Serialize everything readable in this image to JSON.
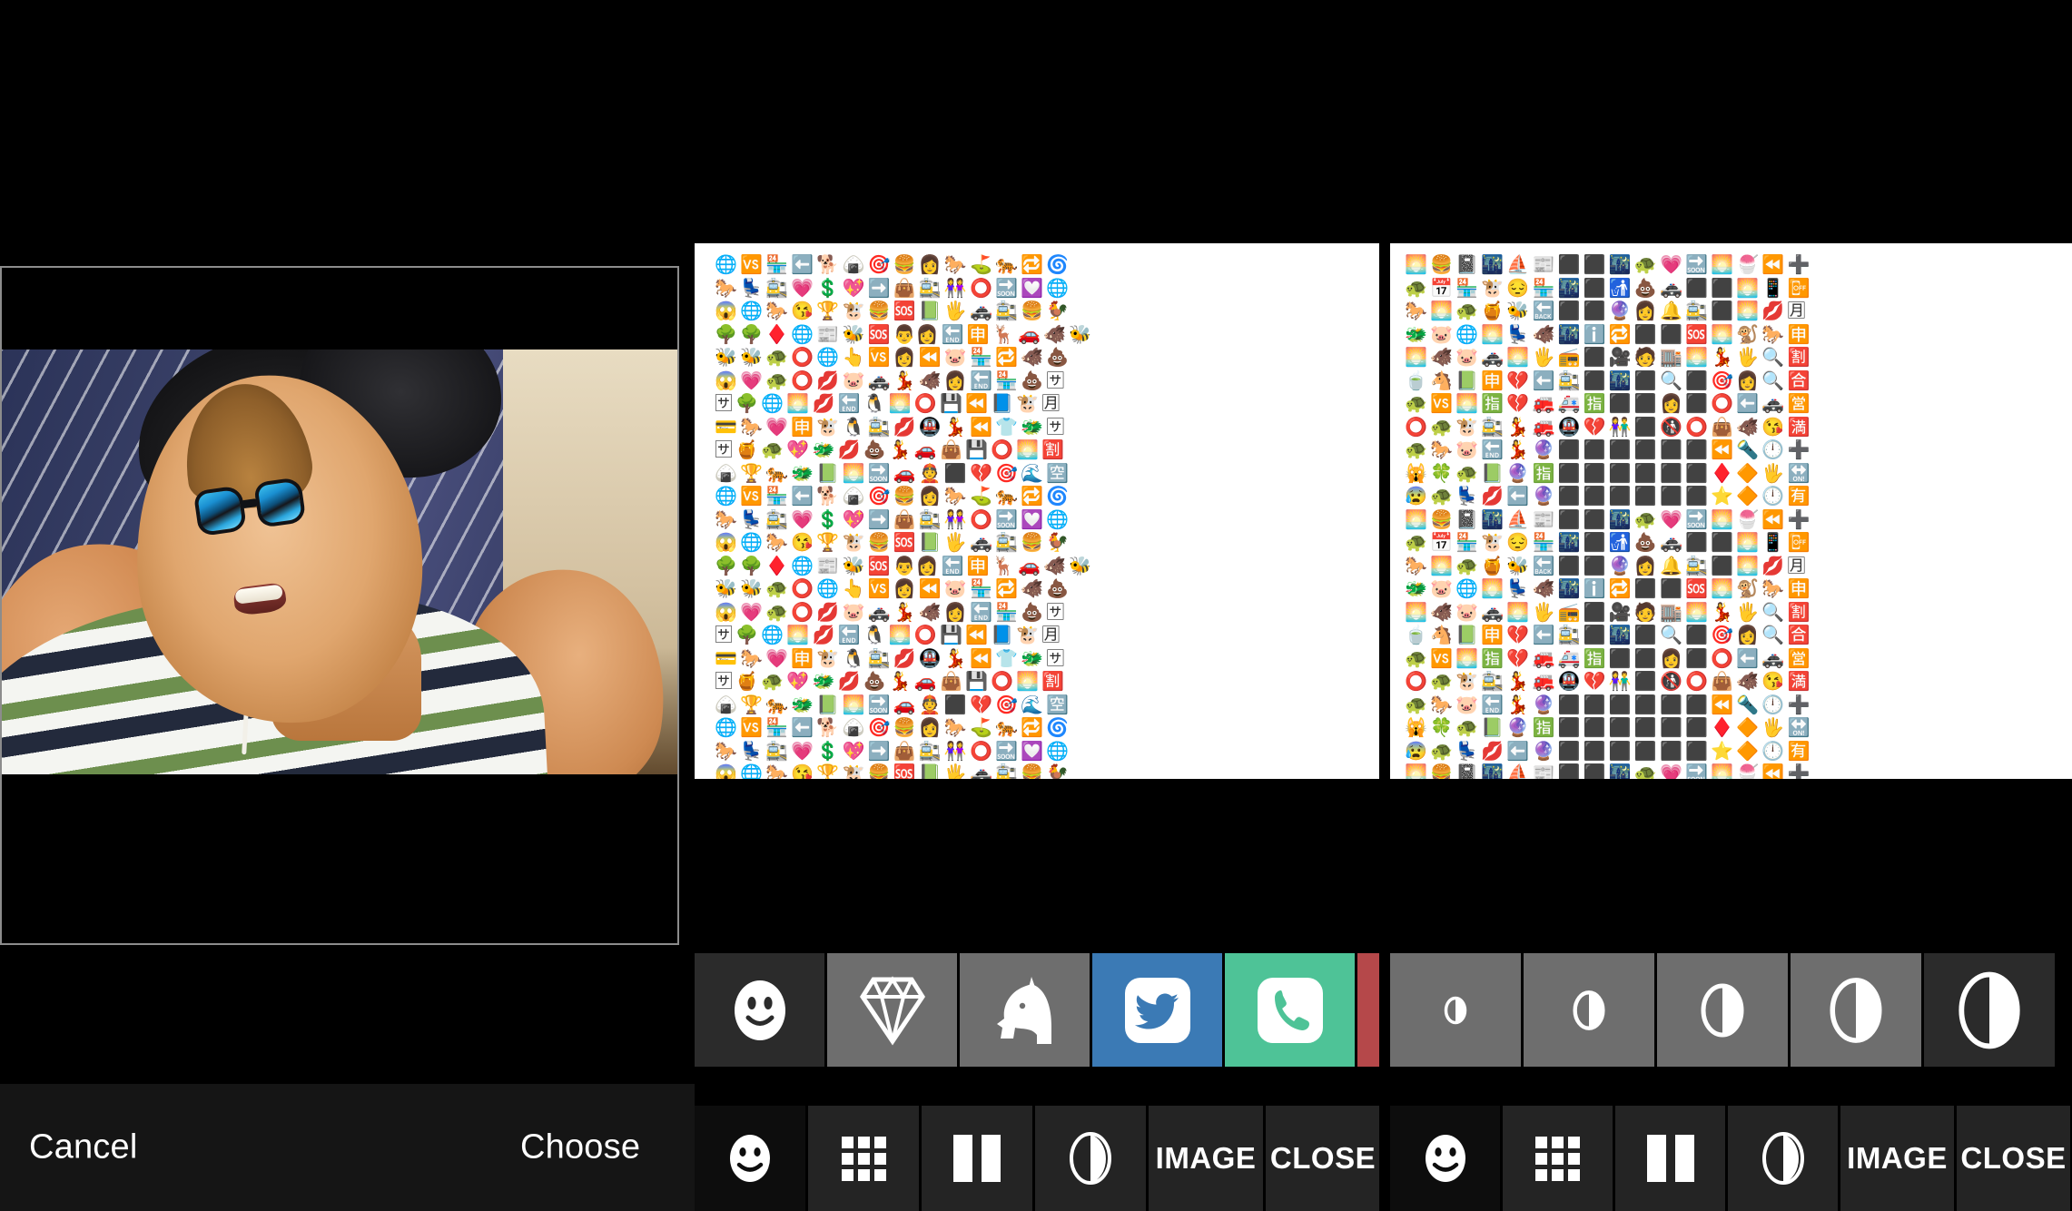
{
  "left_panel": {
    "name": "photo-picker",
    "photo_description": "Selfie of a smiling man wearing mirrored blue sunglasses and a green, white and navy striped t-shirt, lying on a blue pinstriped cushion",
    "crop_frame_color": "#8c8c8c",
    "bar_background": "#151515",
    "cancel_label": "Cancel",
    "choose_label": "Choose"
  },
  "middle_panel": {
    "name": "emoji-image-light",
    "canvas_background": "#ffffff",
    "emoji_rows": [
      "🌐🆚🏪⬅️🐕🍙🎯🍔👩🐎⛳🐅🔁🌀",
      "🐎💺🚉💗💲💖➡️👜🚉👭⭕🔜💟🌐",
      "😱🌐🐎😘🏆🐮🍔🆘📗🖐🚓🚉🍔🐓",
      "🌳🌳♦️🌐📰🐝🆘👨‍👩🔚🈸🦌🚗🐗🐝",
      "🐝🐝🐢⭕🌐👆🆚👩⏪🐷🏪🔁🐗💩",
      "😱💗🐢⭕💋🐷🚓💃🐗👩🔚🏪💩🈂",
      "🈂🌳🌐🌅💋🔚🐧🌅⭕💾⏪📘🐮🈷",
      "💳🐎💗🈸🐮🐧🚉💋🚇💃⏪👕🐲🈂",
      "🈂🍯🐢💖🐲💋💩💃🚗👜💾⭕🌅🈹",
      "🍙🏆🐅🐲📗🌅🔜🚗👲⬛💔🎯🌊🈳"
    ],
    "categories": [
      {
        "id": "smileys",
        "icon": "smiley-icon",
        "color": "#2b2b2b",
        "selected": true
      },
      {
        "id": "objects",
        "icon": "diamond-icon",
        "color": "#6e6e6e",
        "selected": false
      },
      {
        "id": "animals",
        "icon": "unicorn-icon",
        "color": "#6e6e6e",
        "selected": false
      },
      {
        "id": "twitter",
        "icon": "twitter-bird-icon",
        "color": "#3b7ab5",
        "selected": false
      },
      {
        "id": "phone",
        "icon": "phone-handset-icon",
        "color": "#4ec397",
        "selected": false
      },
      {
        "id": "misc",
        "icon": "partial-icon",
        "color": "#b5484a",
        "selected": false
      }
    ],
    "toolbar": [
      {
        "id": "emoji",
        "icon": "smiley-icon",
        "label": "",
        "selected": true
      },
      {
        "id": "grid",
        "icon": "grid-icon",
        "label": "",
        "selected": false
      },
      {
        "id": "columns",
        "icon": "columns-icon",
        "label": "",
        "selected": false
      },
      {
        "id": "contrast",
        "icon": "contrast-icon",
        "label": "",
        "selected": false
      },
      {
        "id": "image",
        "icon": "",
        "label": "IMAGE",
        "selected": false
      },
      {
        "id": "close",
        "icon": "",
        "label": "CLOSE",
        "selected": false
      }
    ]
  },
  "right_panel": {
    "name": "emoji-image-dark",
    "canvas_background": "#ffffff",
    "emoji_rows": [
      "🌅🍔📓🌃⛵📰⬛⬛🌃🐢💗🔜🌅🍧⏪➕",
      "🐢📅🏪🐮😔🏪🌃⬛🚮💩🚓⬛⬛🌅📱📴",
      "🐎🌅🐢🍯🐝🔙⬛⬛🔮👩🔔🚉⬛🌅💋🈷",
      "🐲🐷🌐🌅💺🐗🌃ℹ️🔁⬛⬛🆘🌅🐒🐎🈸",
      "🌅🐗🐷🚓🌅🖐📻⬛🎥🧑🏬🌅💃🖐🔍🈹",
      "🍵🐴📗🈸💔⬅️🚉⬛🌃⬛🔍⬛🎯👩🔍🈴",
      "🐢🆚🌅🈯💔🚒🚑🈯⬛⬛👩⬛⭕⬅️🚓🈺",
      "⭕🐢🐮🚉💃🚒🚇💔👫⬛🚯⭕👜🐗😘🈵",
      "🐢🐎🐷🔚💃🔮⬛⬛⬛⬛⬛⬛⏪🔦🕛➕",
      "🙀🍀🐢📗🔮🈯⬛⬛⬛⬛⬛⬛♦️🔶🖐🔛",
      "😰🐢💺💋⬅️🔮⬛⬛⬛⬛⬛⬛⭐🔶🕛🈶"
    ],
    "size_options": [
      {
        "id": "size-1",
        "icon": "contrast-icon",
        "scale": 0.34,
        "selected": false
      },
      {
        "id": "size-2",
        "icon": "contrast-icon",
        "scale": 0.5,
        "selected": false
      },
      {
        "id": "size-3",
        "icon": "contrast-icon",
        "scale": 0.68,
        "selected": false
      },
      {
        "id": "size-4",
        "icon": "contrast-icon",
        "scale": 0.85,
        "selected": false
      },
      {
        "id": "size-5",
        "icon": "contrast-icon",
        "scale": 1.0,
        "selected": true
      }
    ],
    "tab_background": "#6e6e6e",
    "tab_selected_background": "#2b2b2b",
    "toolbar": [
      {
        "id": "emoji",
        "icon": "smiley-icon",
        "label": "",
        "selected": true
      },
      {
        "id": "grid",
        "icon": "grid-icon",
        "label": "",
        "selected": false
      },
      {
        "id": "columns",
        "icon": "columns-icon",
        "label": "",
        "selected": false
      },
      {
        "id": "contrast",
        "icon": "contrast-icon",
        "label": "",
        "selected": false
      },
      {
        "id": "image",
        "icon": "",
        "label": "IMAGE",
        "selected": false
      },
      {
        "id": "close",
        "icon": "",
        "label": "CLOSE",
        "selected": false
      }
    ]
  }
}
